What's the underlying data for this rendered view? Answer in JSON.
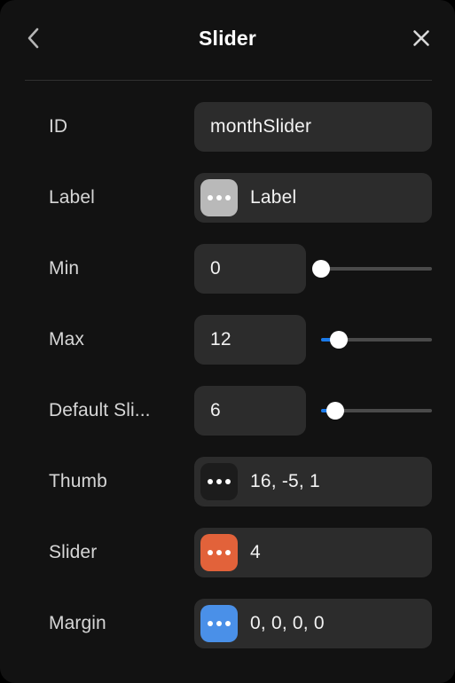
{
  "window": {
    "background": "#121212",
    "accent_blue": "#1a7aea"
  },
  "header": {
    "title": "Slider",
    "back_icon": "chevron-left-icon",
    "close_icon": "close-icon"
  },
  "rows": [
    {
      "label": "ID",
      "value": "monthSlider",
      "field_width": "wide",
      "badge": null,
      "slider": null
    },
    {
      "label": "Label",
      "value": "Label",
      "field_width": "wide",
      "badge": {
        "color": "#b9b9b9",
        "icon": "ellipsis-icon"
      },
      "slider": null
    },
    {
      "label": "Min",
      "value": "0",
      "field_width": "narrow",
      "badge": null,
      "slider": {
        "percent": 0,
        "fill_percent": 0
      }
    },
    {
      "label": "Max",
      "value": "12",
      "field_width": "narrow",
      "badge": null,
      "slider": {
        "percent": 16,
        "fill_percent": 16
      }
    },
    {
      "label": "Default Sli...",
      "value": "6",
      "field_width": "narrow",
      "badge": null,
      "slider": {
        "percent": 13,
        "fill_percent": 13
      }
    },
    {
      "label": "Thumb",
      "value": "16, -5, 1",
      "field_width": "wide",
      "badge": {
        "color": "#1c1c1c",
        "icon": "ellipsis-icon"
      },
      "slider": null
    },
    {
      "label": "Slider",
      "value": "4",
      "field_width": "wide",
      "badge": {
        "color": "#e2623a",
        "icon": "ellipsis-icon"
      },
      "slider": null
    },
    {
      "label": "Margin",
      "value": "0, 0, 0, 0",
      "field_width": "wide",
      "badge": {
        "color": "#4a90e8",
        "icon": "ellipsis-icon"
      },
      "slider": null
    }
  ]
}
